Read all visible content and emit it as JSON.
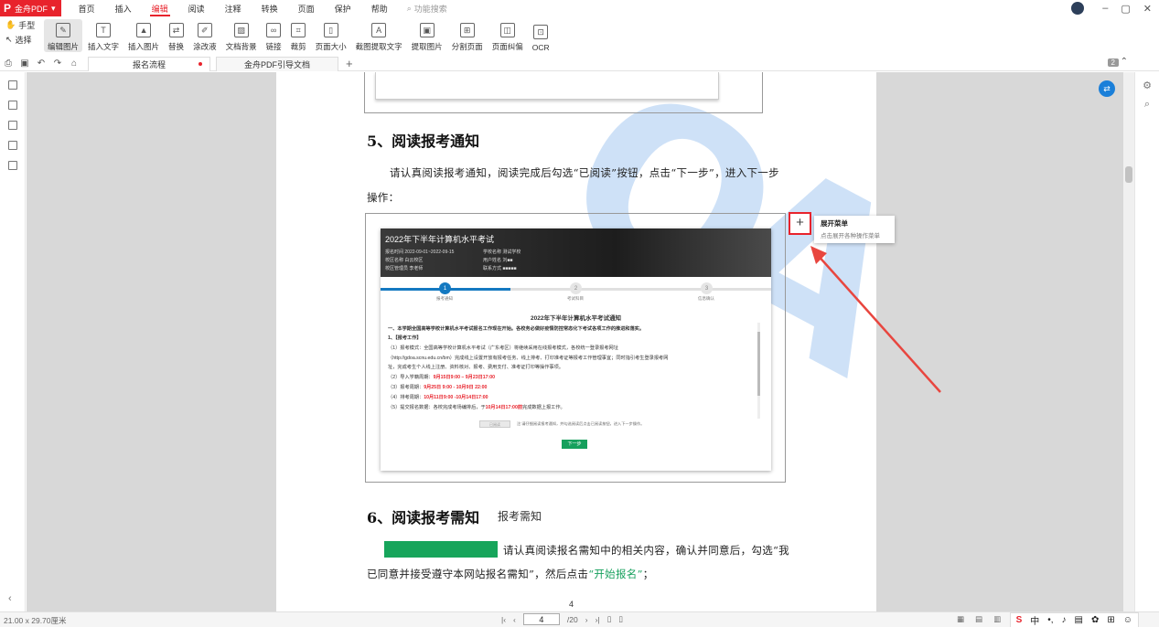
{
  "app": {
    "logo": "P",
    "name": "金舟PDF",
    "dropdown": "▾"
  },
  "menu": [
    "首页",
    "插入",
    "编辑",
    "阅读",
    "注释",
    "转换",
    "页面",
    "保护",
    "帮助"
  ],
  "menu_active": "编辑",
  "search_placeholder": "功能搜索",
  "window_controls": {
    "minimize": "–",
    "maximize": "▢",
    "close": "✕"
  },
  "modes": {
    "hand": "手型",
    "select": "选择"
  },
  "tools": [
    {
      "label": "编辑图片",
      "icon": "edit-image-icon",
      "glyph": "✎"
    },
    {
      "label": "插入文字",
      "icon": "insert-text-icon",
      "glyph": "T"
    },
    {
      "label": "插入图片",
      "icon": "insert-image-icon",
      "glyph": "▲"
    },
    {
      "label": "替换",
      "icon": "replace-icon",
      "glyph": "⇄"
    },
    {
      "label": "涂改液",
      "icon": "correction-icon",
      "glyph": "✐"
    },
    {
      "label": "文档背景",
      "icon": "background-icon",
      "glyph": "▨"
    },
    {
      "label": "链接",
      "icon": "link-icon",
      "glyph": "∞"
    },
    {
      "label": "裁剪",
      "icon": "crop-icon",
      "glyph": "⌗"
    },
    {
      "label": "页面大小",
      "icon": "page-size-icon",
      "glyph": "▯"
    },
    {
      "label": "截图提取文字",
      "icon": "ocr-capture-icon",
      "glyph": "A"
    },
    {
      "label": "提取图片",
      "icon": "extract-image-icon",
      "glyph": "▣"
    },
    {
      "label": "分割页面",
      "icon": "split-page-icon",
      "glyph": "⊞"
    },
    {
      "label": "页面纠偏",
      "icon": "deskew-icon",
      "glyph": "◫"
    },
    {
      "label": "OCR",
      "icon": "ocr-icon",
      "glyph": "⊡"
    }
  ],
  "tabs": [
    {
      "label": "报名流程",
      "modified": true
    },
    {
      "label": "金舟PDF引导文档",
      "modified": false
    }
  ],
  "page_count_badge": "2",
  "document": {
    "h5": "5、阅读报考通知",
    "p5_line1": "请认真阅读报考通知，阅读完成后勾选“已阅读”按钮，点击“下一步”，进入下一步",
    "p5_line2": "操作：",
    "h6": "6、阅读报考需知",
    "h6_sub": "报考需知",
    "p6_line1": "请认真阅读报名需知中的相关内容，确认并同意后，勾选“我",
    "p6_line2_a": "已同意并接受遵守本网站报名需知”，然后点击",
    "p6_line2_b": "“开始报名”",
    "p6_line2_c": "；",
    "page_number": "4",
    "watermark": "OA"
  },
  "screenshot": {
    "title": "2022年下半年计算机水平考试",
    "info_left": [
      "报名时间  2022-09-01~2022-09-15",
      "校区名称  白云校区",
      "校区管理员  李老师"
    ],
    "info_right": [
      "学校名称  测试学校",
      "用户姓名  刘■■",
      "联系方式  ■■■■■"
    ],
    "steps": [
      "报考通知",
      "考试科目",
      "信息确认"
    ],
    "notice_title": "2022年下半年计算机水平考试通知",
    "lines": [
      "一、本学期全国高等学校计算机水平考试报名工作现在开始。各校务必做好疫情防控常态化下考试各项工作的推进和落实。",
      "1、【报考工作】",
      "（1）报考模式：全国高等学校计算机水平考试（广东考区）将继续采用在线报考模式，各校统一登录报考网址",
      "（http://gdoa.scnu.edu.cn/bm）完成线上设置开放有报考任务、线上排考、打印准考证等报考工作管理事宜；同时指引考生登录报考网",
      "址，完成考生个人线上注册、资料核对、报考、费用支付、准考证打印等操作事项。"
    ],
    "deadline_lines": [
      {
        "prefix": "（2）导入学籍周期：",
        "date": "9月15日9:00 – 9月23日17:00",
        "suffix": ""
      },
      {
        "prefix": "（3）报考周期：",
        "date": "9月25日 9:00 - 10月9日 22:00",
        "suffix": ""
      },
      {
        "prefix": "（4）排考周期：",
        "date": "10月11日9:00 -10月14日17:00",
        "suffix": ""
      },
      {
        "prefix": "（5）提交报名数据：各校完成考场编排后，于",
        "date": "10月14日17:00前",
        "suffix": "完成数据上报工作。"
      }
    ],
    "agree_label": "已阅读",
    "agree_note": "注:请仔细阅读报考通知，并勾选阅读后点击已阅读按钮，进入下一步操作。",
    "next_button": "下一步"
  },
  "expand_tooltip": {
    "button": "+",
    "title": "展开菜单",
    "desc": "点击展开各种操作菜单"
  },
  "status": {
    "page_size": "21.00 x 29.70厘米",
    "current_page": "4",
    "total_pages": "/20"
  },
  "ime": {
    "logo": "S",
    "lang": "中",
    "punct": "•,"
  },
  "colors": {
    "brand_red": "#e8232c",
    "accent_blue": "#1479c1",
    "green": "#17a55b"
  }
}
